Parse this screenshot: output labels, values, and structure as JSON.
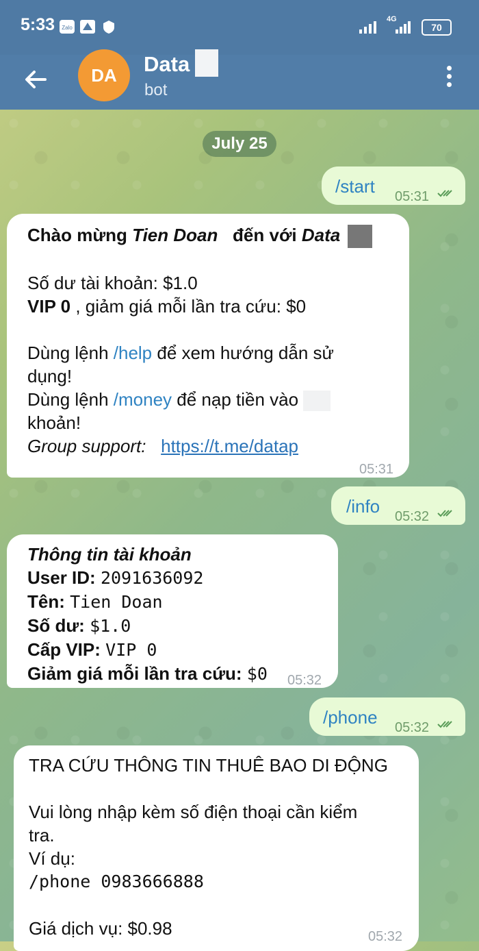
{
  "status": {
    "time": "5:33",
    "network": "4G",
    "battery": "70"
  },
  "header": {
    "avatar_initials": "DA",
    "title": "Data",
    "subtitle": "bot"
  },
  "date_label": "July 25",
  "messages": {
    "m1": {
      "text": "/start",
      "time": "05:31"
    },
    "m2": {
      "welcome_prefix": "Chào mừng ",
      "welcome_name": "Tien Doan",
      "welcome_mid": "đến với ",
      "welcome_bot": "Data",
      "balance": "Số dư tài khoản: $1.0",
      "vip_bold": "VIP 0",
      "vip_rest": " , giảm giá mỗi lần tra cứu: $0",
      "help_pre": "Dùng lệnh ",
      "help_cmd": "/help",
      "help_post": " để xem hướng dẫn sử",
      "help_post2": "dụng!",
      "money_pre": "Dùng lệnh ",
      "money_cmd": "/money",
      "money_post": " để nạp tiền vào",
      "money_post2": "khoản!",
      "group_label": "Group support:",
      "group_link": "https://t.me/datap",
      "time": "05:31"
    },
    "m3": {
      "text": "/info",
      "time": "05:32"
    },
    "m4": {
      "title": "Thông tin tài khoản",
      "rows": [
        {
          "label": "User ID:",
          "value": "2091636092"
        },
        {
          "label": "Tên:",
          "value": "Tien Doan"
        },
        {
          "label": "Số dư:",
          "value": "$1.0"
        },
        {
          "label": "Cấp VIP:",
          "value": "VIP 0"
        },
        {
          "label": "Giảm giá mỗi lần tra cứu:",
          "value": "$0"
        }
      ],
      "time": "05:32"
    },
    "m5": {
      "text": "/phone",
      "time": "05:32"
    },
    "m6": {
      "title": "TRA CỨU THÔNG TIN THUÊ BAO DI ĐỘNG",
      "line1": "Vui lòng nhập kèm số điện thoại cần kiểm",
      "line2": "tra.",
      "example_label": "Ví dụ:",
      "example": "/phone 0983666888",
      "price": "Giá dịch vụ: $0.98",
      "time": "05:32"
    }
  },
  "colors": {
    "header": "#517da8",
    "avatar": "#f39a34",
    "outgoing": "#e8fad6",
    "incoming": "#ffffff",
    "command": "#2f83c2"
  }
}
